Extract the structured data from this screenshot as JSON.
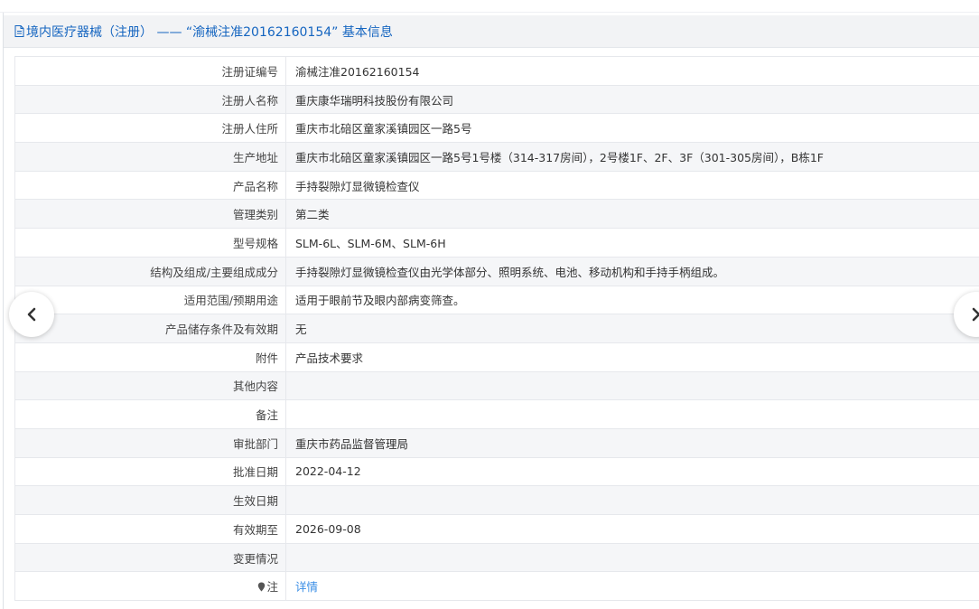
{
  "header": {
    "title": "境内医疗器械（注册） —— “渝械注准20162160154” 基本信息"
  },
  "rows": [
    {
      "label": "注册证编号",
      "value": "渝械注准20162160154"
    },
    {
      "label": "注册人名称",
      "value": "重庆康华瑞明科技股份有限公司"
    },
    {
      "label": "注册人住所",
      "value": "重庆市北碚区童家溪镇园区一路5号"
    },
    {
      "label": "生产地址",
      "value": "重庆市北碚区童家溪镇园区一路5号1号楼（314-317房间），2号楼1F、2F、3F（301-305房间），B栋1F"
    },
    {
      "label": "产品名称",
      "value": "手持裂隙灯显微镜检查仪"
    },
    {
      "label": "管理类别",
      "value": "第二类"
    },
    {
      "label": "型号规格",
      "value": "SLM-6L、SLM-6M、SLM-6H"
    },
    {
      "label": "结构及组成/主要组成成分",
      "value": "手持裂隙灯显微镜检查仪由光学体部分、照明系统、电池、移动机构和手持手柄组成。"
    },
    {
      "label": "适用范围/预期用途",
      "value": "适用于眼前节及眼内部病变筛查。"
    },
    {
      "label": "产品储存条件及有效期",
      "value": "无"
    },
    {
      "label": "附件",
      "value": "产品技术要求"
    },
    {
      "label": "其他内容",
      "value": ""
    },
    {
      "label": "备注",
      "value": ""
    },
    {
      "label": "审批部门",
      "value": "重庆市药品监督管理局"
    },
    {
      "label": "批准日期",
      "value": "2022-04-12"
    },
    {
      "label": "生效日期",
      "value": ""
    },
    {
      "label": "有效期至",
      "value": "2026-09-08"
    },
    {
      "label": "变更情况",
      "value": ""
    },
    {
      "label": "注",
      "value": "详情"
    }
  ],
  "nav": {
    "prev_glyph": "<",
    "next_glyph": ">"
  },
  "colors": {
    "accent": "#1565c0",
    "link": "#3a8ee6",
    "header_bg": "#f2f3f5",
    "stripe_bg": "#f5f6f8"
  }
}
